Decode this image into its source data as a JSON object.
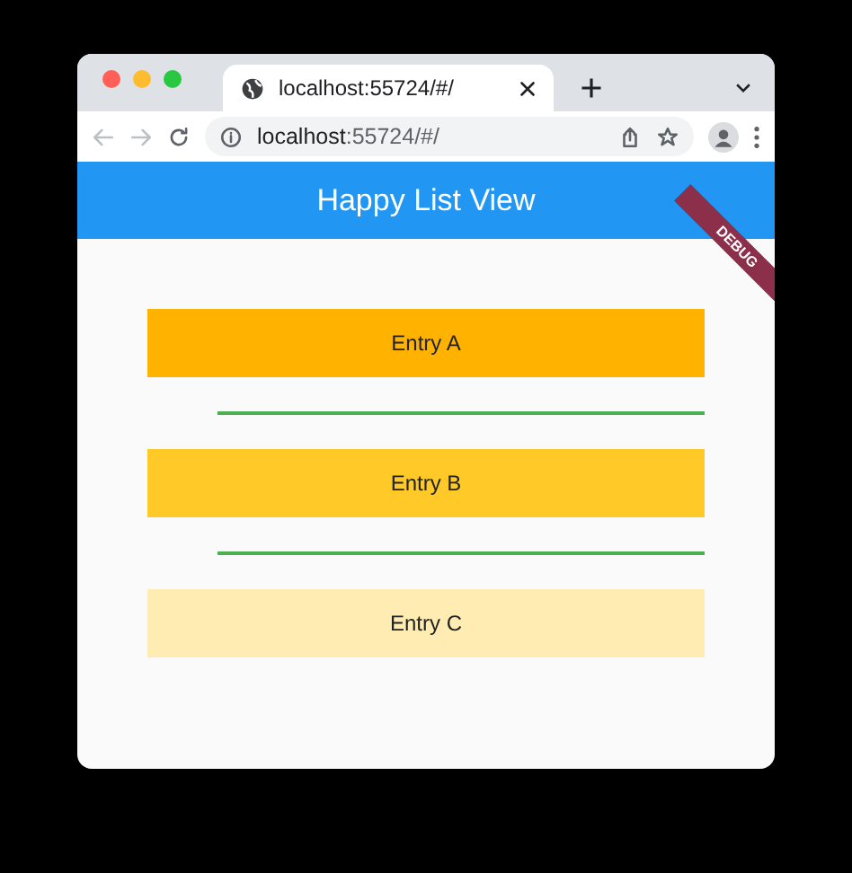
{
  "browser": {
    "tab": {
      "title": "localhost:55724/#/",
      "selected": true
    },
    "address": "**localhost**:55724/#/"
  },
  "app_bar": {
    "title": "Happy List View"
  },
  "debug_banner": "DEBUG",
  "entries": [
    {
      "label": "Entry A",
      "color": "#ffb300"
    },
    {
      "label": "Entry B",
      "color": "#ffca28"
    },
    {
      "label": "Entry C",
      "color": "#ffecb3"
    }
  ]
}
